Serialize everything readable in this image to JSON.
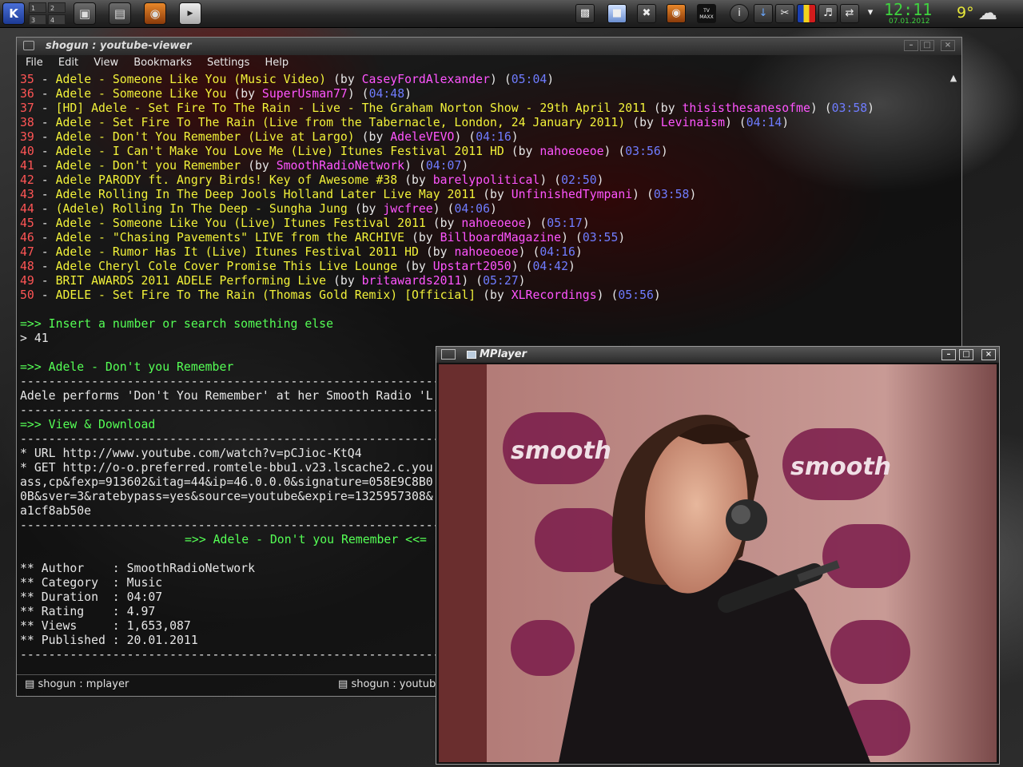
{
  "panel": {
    "pager": [
      "1",
      "2",
      "3",
      "4"
    ],
    "launchers": [
      "terminal-icon",
      "file-manager-icon",
      "firefox-icon",
      "mplayer-icon"
    ],
    "tray": [
      "monitor-icon",
      "package-icon",
      "tools-icon",
      "firefox-icon",
      "tv-icon",
      "info-icon",
      "download-icon",
      "scissors-icon",
      "flag-icon",
      "volume-icon",
      "network-icon",
      "chevron-down-icon"
    ],
    "tv_icon_label": "TV MAXX",
    "clock_time": "12:11",
    "clock_date": "07.01.2012",
    "weather_temp": "9°"
  },
  "terminal": {
    "title": "shogun : youtube-viewer",
    "menu": [
      "File",
      "Edit",
      "View",
      "Bookmarks",
      "Settings",
      "Help"
    ],
    "results": [
      {
        "num": "35",
        "title": "Adele - Someone Like You (Music Video)",
        "author": "CaseyFordAlexander",
        "duration": "05:04"
      },
      {
        "num": "36",
        "title": "Adele - Someone Like You",
        "author": "SuperUsman77",
        "duration": "04:48"
      },
      {
        "num": "37",
        "title": "[HD] Adele - Set Fire To The Rain - Live - The Graham Norton Show - 29th April 2011",
        "author": "thisisthesanesofme",
        "duration": "03:58"
      },
      {
        "num": "38",
        "title": "Adele - Set Fire To The Rain (Live from the Tabernacle, London, 24 January 2011)",
        "author": "Levinaism",
        "duration": "04:14"
      },
      {
        "num": "39",
        "title": "Adele - Don't You Remember (Live at Largo)",
        "author": "AdeleVEVO",
        "duration": "04:16"
      },
      {
        "num": "40",
        "title": "Adele - I Can't Make You Love Me (Live) Itunes Festival 2011 HD",
        "author": "nahoeoeoe",
        "duration": "03:56"
      },
      {
        "num": "41",
        "title": "Adele - Don't you Remember",
        "author": "SmoothRadioNetwork",
        "duration": "04:07"
      },
      {
        "num": "42",
        "title": "Adele PARODY ft. Angry Birds! Key of Awesome #38",
        "author": "barelypolitical",
        "duration": "02:50"
      },
      {
        "num": "43",
        "title": "Adele Rolling In The Deep Jools Holland Later Live May 2011",
        "author": "UnfinishedTympani",
        "duration": "03:58"
      },
      {
        "num": "44",
        "title": "(Adele) Rolling In The Deep - Sungha Jung",
        "author": "jwcfree",
        "duration": "04:06"
      },
      {
        "num": "45",
        "title": "Adele - Someone Like You (Live) Itunes Festival 2011",
        "author": "nahoeoeoe",
        "duration": "05:17"
      },
      {
        "num": "46",
        "title": "Adele - \"Chasing Pavements\" LIVE from the ARCHIVE",
        "author": "BillboardMagazine",
        "duration": "03:55"
      },
      {
        "num": "47",
        "title": "Adele - Rumor Has It (Live) Itunes Festival 2011 HD",
        "author": "nahoeoeoe",
        "duration": "04:16"
      },
      {
        "num": "48",
        "title": "Adele Cheryl Cole Cover Promise This Live Lounge",
        "author": "Upstart2050",
        "duration": "04:42"
      },
      {
        "num": "49",
        "title": "BRIT AWARDS 2011 ADELE Performing Live",
        "author": "britawards2011",
        "duration": "05:27"
      },
      {
        "num": "50",
        "title": "ADELE - Set Fire To The Rain (Thomas Gold Remix) [Official]",
        "author": "XLRecordings",
        "duration": "05:56"
      }
    ],
    "prompt_arrow": "=>>",
    "prompt_text": "Insert a number or search something else",
    "input_line": "> 41",
    "selected_header": "Adele - Don't you Remember",
    "separator": "--------------------------------------------------------------------------------------------------------------------------------",
    "description": "Adele performs 'Don't You Remember' at her Smooth Radio 'L",
    "view_download": "View & Download",
    "url_line": "* URL http://www.youtube.com/watch?v=pCJioc-KtQ4",
    "get_lines": [
      "* GET http://o-o.preferred.romtele-bbu1.v23.lscache2.c.you",
      "ass,cp&fexp=913602&itag=44&ip=46.0.0.0&signature=058E9C8B0",
      "0B&sver=3&ratebypass=yes&source=youtube&expire=1325957308&",
      "a1cf8ab50e"
    ],
    "centered_title": "=>> Adele - Don't you Remember <<=",
    "info": [
      {
        "label": "** Author    :",
        "value": "SmoothRadioNetwork"
      },
      {
        "label": "** Category  :",
        "value": "Music"
      },
      {
        "label": "** Duration  :",
        "value": "04:07"
      },
      {
        "label": "** Rating    :",
        "value": "4.97"
      },
      {
        "label": "** Views     :",
        "value": "1,653,087"
      },
      {
        "label": "** Published :",
        "value": "20.01.2011"
      }
    ],
    "tabs": [
      "shogun : mplayer",
      "shogun : youtub"
    ]
  },
  "mplayer": {
    "title": "MPlayer",
    "video_caption": "smooth"
  },
  "colors": {
    "number": "#ff5555",
    "title": "#f2f23a",
    "author": "#ff55ff",
    "duration": "#6f7cff",
    "prompt": "#55ff55",
    "clock": "#3fd33f"
  }
}
